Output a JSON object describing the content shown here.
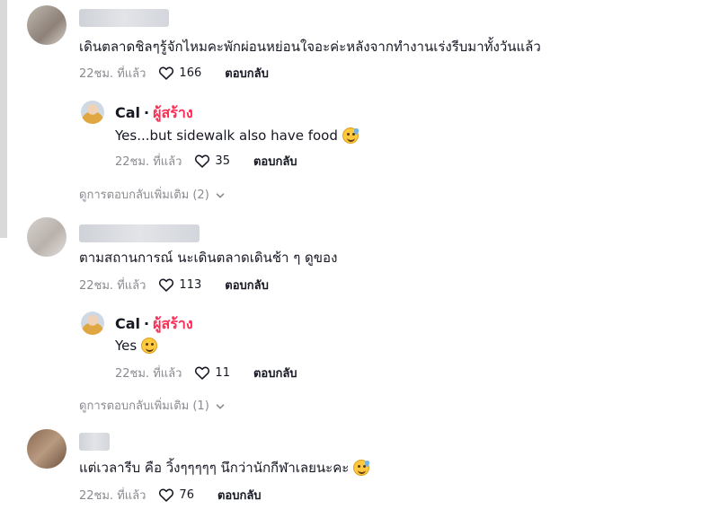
{
  "comments": [
    {
      "text": "เดินตลาดชิลๆรู้จักไหมคะพักผ่อนหย่อนใจอะค่ะหลังจากทำงานเร่งรีบมาทั้งวันแล้ว",
      "time": "22ชม. ที่แล้ว",
      "likes": "166",
      "reply_label": "ตอบกลับ",
      "reply": {
        "name": "Cal",
        "separator": "·",
        "creator_label": "ผู้สร้าง",
        "text": "Yes...but sidewalk also have food",
        "emoji": "sweat-smile-emoji",
        "time": "22ชม. ที่แล้ว",
        "likes": "35",
        "reply_label": "ตอบกลับ"
      },
      "more_replies": "ดูการตอบกลับเพิ่มเติม (2)"
    },
    {
      "text": "ตามสถานการณ์ นะเดินตลาดเดินช้า ๆ ดูของ",
      "time": "22ชม. ที่แล้ว",
      "likes": "113",
      "reply_label": "ตอบกลับ",
      "reply": {
        "name": "Cal",
        "separator": "·",
        "creator_label": "ผู้สร้าง",
        "text": "Yes",
        "emoji": "smile-emoji",
        "time": "22ชม. ที่แล้ว",
        "likes": "11",
        "reply_label": "ตอบกลับ"
      },
      "more_replies": "ดูการตอบกลับเพิ่มเติม (1)"
    },
    {
      "text": "แต่เวลารีบ คือ วิ้งๆๆๆๆๆ นึกว่านักกีฬาเลยนะคะ",
      "emoji": "sweat-smile-emoji",
      "time": "22ชม. ที่แล้ว",
      "likes": "76",
      "reply_label": "ตอบกลับ"
    }
  ],
  "colors": {
    "creator_accent": "#fe2c55",
    "muted_text": "#8a8b91",
    "primary_text": "#161823"
  }
}
